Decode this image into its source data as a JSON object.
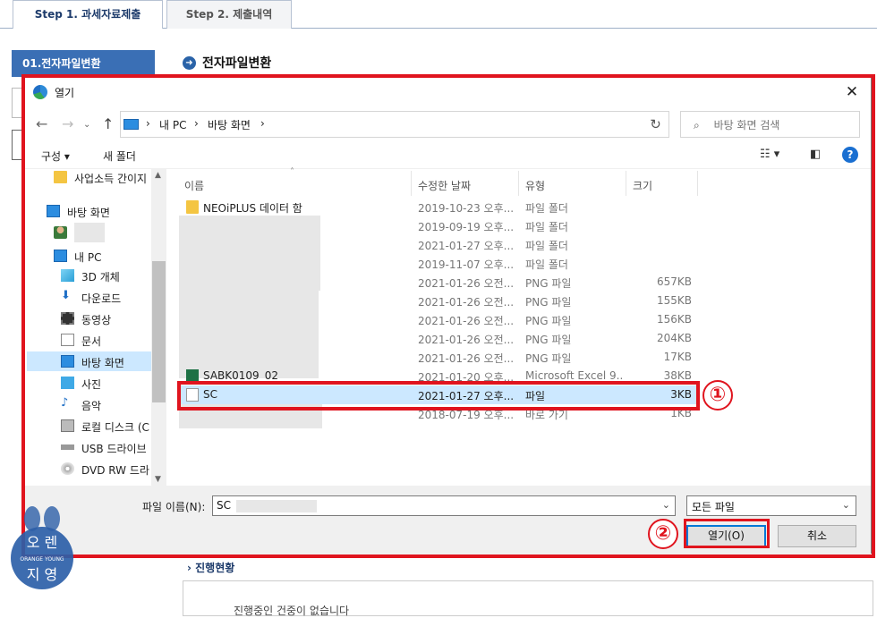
{
  "web": {
    "tabs": [
      "Step 1. 과세자료제출",
      "Step 2. 제출내역"
    ],
    "side_menu": "01.전자파일변환",
    "page_title": "전자파일변환",
    "progress_title": "진행현황",
    "progress_text": "진행중인 건중이 없습니다"
  },
  "dialog": {
    "title": "열기",
    "breadcrumb": [
      "내 PC",
      "바탕 화면"
    ],
    "search_placeholder": "바탕 화면 검색",
    "toolbar": {
      "organize": "구성",
      "new_folder": "새 폴더"
    },
    "tree": [
      {
        "label": "사업소득 간이지",
        "icon": "folder-icon"
      },
      {
        "label": "바탕 화면",
        "icon": "desktop-icon"
      },
      {
        "label": "",
        "icon": "user-icon"
      },
      {
        "label": "내 PC",
        "icon": "pc-icon"
      },
      {
        "label": "3D 개체",
        "icon": "cube-icon"
      },
      {
        "label": "다운로드",
        "icon": "download-icon"
      },
      {
        "label": "동영상",
        "icon": "video-icon"
      },
      {
        "label": "문서",
        "icon": "document-icon"
      },
      {
        "label": "바탕 화면",
        "icon": "desktop-icon"
      },
      {
        "label": "사진",
        "icon": "picture-icon"
      },
      {
        "label": "음악",
        "icon": "music-icon"
      },
      {
        "label": "로컬 디스크 (C",
        "icon": "disk-icon"
      },
      {
        "label": "USB 드라이브",
        "icon": "usb-icon"
      },
      {
        "label": "DVD RW 드라",
        "icon": "dvd-icon"
      }
    ],
    "columns": [
      "이름",
      "수정한 날짜",
      "유형",
      "크기"
    ],
    "files": [
      {
        "name": "NEOiPLUS 데이터 함",
        "date": "2019-10-23 오후...",
        "type": "파일 폴더",
        "size": "",
        "icon": "folder-icon"
      },
      {
        "name": "",
        "date": "2019-09-19 오후...",
        "type": "파일 폴더",
        "size": "",
        "icon": ""
      },
      {
        "name": "",
        "date": "2021-01-27 오후...",
        "type": "파일 폴더",
        "size": "",
        "icon": ""
      },
      {
        "name": "",
        "date": "2019-11-07 오후...",
        "type": "파일 폴더",
        "size": "",
        "icon": ""
      },
      {
        "name": "",
        "date": "2021-01-26 오전...",
        "type": "PNG 파일",
        "size": "657KB",
        "icon": ""
      },
      {
        "name": "",
        "date": "2021-01-26 오전...",
        "type": "PNG 파일",
        "size": "155KB",
        "icon": ""
      },
      {
        "name": "",
        "date": "2021-01-26 오전...",
        "type": "PNG 파일",
        "size": "156KB",
        "icon": ""
      },
      {
        "name": "",
        "date": "2021-01-26 오전...",
        "type": "PNG 파일",
        "size": "204KB",
        "icon": ""
      },
      {
        "name": "",
        "date": "2021-01-26 오전...",
        "type": "PNG 파일",
        "size": "17KB",
        "icon": ""
      },
      {
        "name": "SABK0109_02",
        "date": "2021-01-20 오후...",
        "type": "Microsoft Excel 9...",
        "size": "38KB",
        "icon": "excel-icon"
      },
      {
        "name": "SC",
        "date": "2021-01-27 오후...",
        "type": "파일",
        "size": "3KB",
        "icon": "file-icon",
        "selected": true
      },
      {
        "name": "",
        "date": "2018-07-19 오후...",
        "type": "바로 가기",
        "size": "1KB",
        "icon": ""
      }
    ],
    "filename_label": "파일 이름(N):",
    "filename_value": "SC",
    "filter_value": "모든 파일",
    "open_button": "열기(O)",
    "cancel_button": "취소"
  },
  "annotations": {
    "step1": "①",
    "step2": "②"
  },
  "colors": {
    "highlight_red": "#e0141e",
    "selection_blue": "#cce8ff",
    "accent_blue": "#0078d7"
  }
}
